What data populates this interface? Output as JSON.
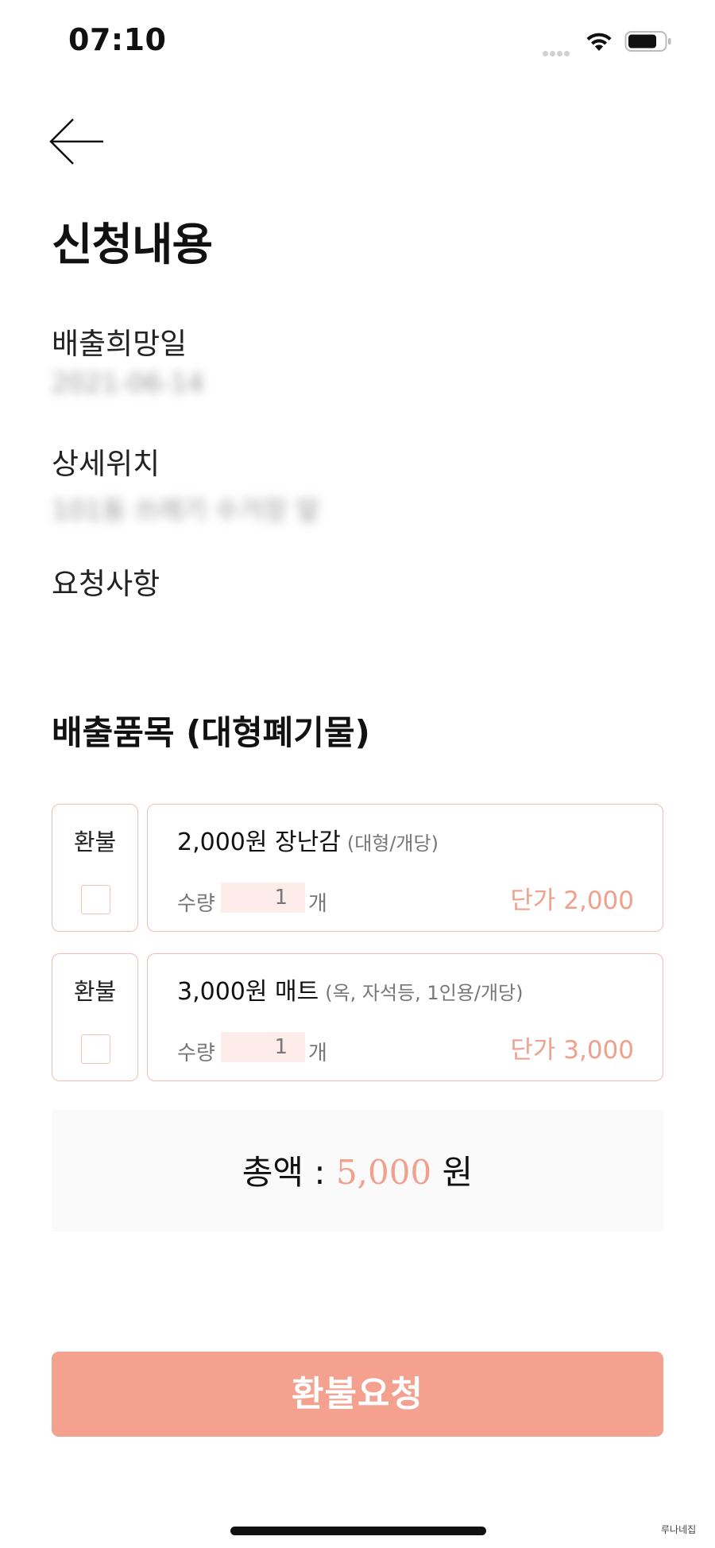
{
  "status_bar": {
    "time": "07:10"
  },
  "page_title": "신청내용",
  "fields": {
    "date_label": "배출희망일",
    "date_value": "2021-06-14",
    "location_label": "상세위치",
    "location_value": "101동 쓰레기 수거장 앞",
    "request_label": "요청사항",
    "request_value": ""
  },
  "section_title": "배출품목 (대형폐기물)",
  "items": [
    {
      "refund_label": "환불",
      "refund_checked": false,
      "name": "2,000원 장난감",
      "desc": "(대형/개당)",
      "qty_label": "수량",
      "qty": "1",
      "qty_unit": "개",
      "unit_price": "단가 2,000"
    },
    {
      "refund_label": "환불",
      "refund_checked": false,
      "name": "3,000원 매트",
      "desc": "(옥, 자석등, 1인용/개당)",
      "qty_label": "수량",
      "qty": "1",
      "qty_unit": "개",
      "unit_price": "단가 3,000"
    }
  ],
  "total": {
    "label": "총액 : ",
    "amount": "5,000",
    "unit": " 원"
  },
  "refund_button": "환불요청",
  "watermark": "루나네집",
  "colors": {
    "accent": "#f4a190",
    "accent_text": "#f0a08c",
    "border": "#f0bdb0",
    "qty_bg": "#fdecea"
  },
  "icons": {
    "back": "arrow-left-icon",
    "wifi": "wifi-icon",
    "battery": "battery-icon",
    "signal": "signal-icon"
  }
}
